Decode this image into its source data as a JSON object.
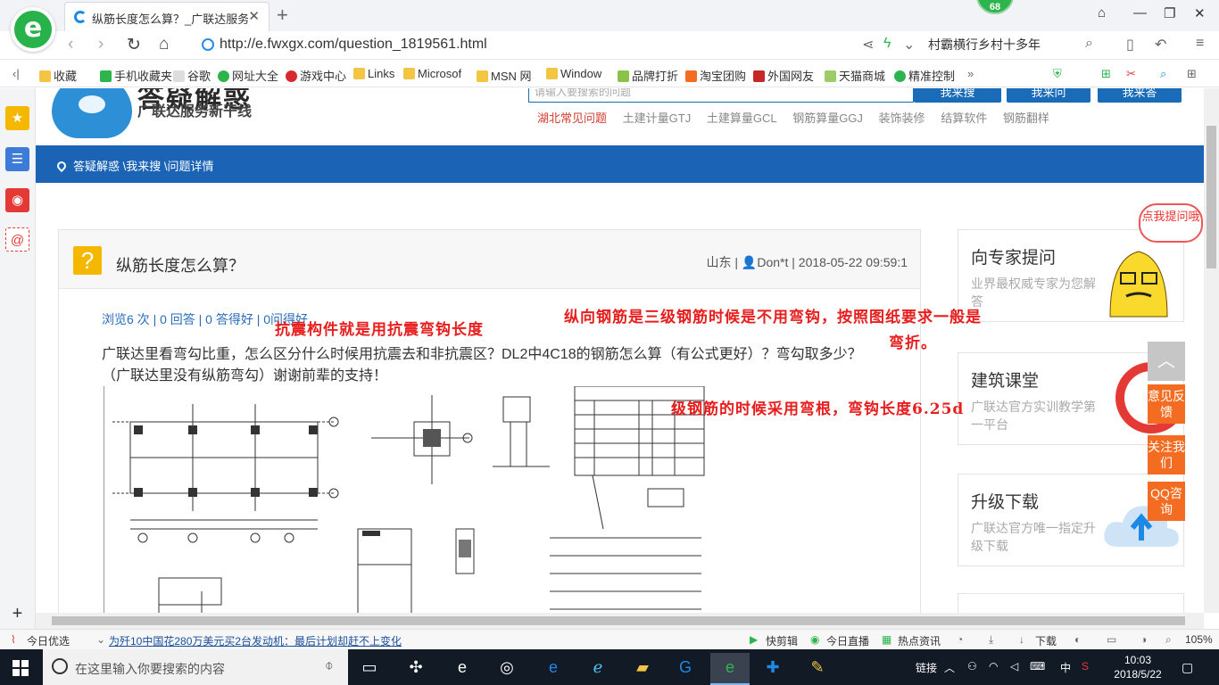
{
  "browser": {
    "tab_title": "纵筋长度怎么算？_广联达服务新",
    "tab_close": "✕",
    "new_tab": "+",
    "badge": "68",
    "url": "http://e.fwxgx.com/question_1819561.html",
    "search_text": "村霸横行乡村十多年"
  },
  "favorites": [
    {
      "label": "收藏",
      "color": "#f4c542"
    },
    {
      "label": "手机收藏夹",
      "color": "#2db44d"
    },
    {
      "label": "谷歌",
      "color": "#dddddd"
    },
    {
      "label": "网址大全",
      "color": "#2db44d"
    },
    {
      "label": "游戏中心",
      "color": "#d7282f"
    },
    {
      "label": "Links",
      "color": "#f4c542"
    },
    {
      "label": "Microsof",
      "color": "#f4c542"
    },
    {
      "label": "MSN 网",
      "color": "#f4c542"
    },
    {
      "label": "Window",
      "color": "#f4c542"
    },
    {
      "label": "品牌打折",
      "color": "#8bc34a"
    },
    {
      "label": "淘宝团购",
      "color": "#f36c21"
    },
    {
      "label": "外国网友",
      "color": "#c62828"
    },
    {
      "label": "天猫商城",
      "color": "#9ccc65"
    },
    {
      "label": "精准控制",
      "color": "#2db44d"
    }
  ],
  "page": {
    "logo_title": "答疑解惑",
    "logo_subtitle": "广联达服务新干线",
    "search_placeholder": "请输入要搜索的问题",
    "search_buttons": [
      "我来搜",
      "我来问",
      "我来答"
    ],
    "hotlinks": [
      "湖北常见问题",
      "土建计量GTJ",
      "土建算量GCL",
      "钢筋算量GGJ",
      "装饰装修",
      "结算软件",
      "钢筋翻样"
    ],
    "breadcrumb": "答疑解惑 \\我来搜 \\问题详情",
    "question": {
      "mark": "?",
      "title": "纵筋长度怎么算？",
      "meta_region": "山东",
      "meta_user": "Don*t",
      "meta_time": "2018-05-22 09:59:1",
      "stats": "浏览6 次 | 0 回答 | 0 答得好 | 0问得好",
      "body": "广联达里看弯勾比重，怎么区分什么时候用抗震去和非抗震区？DL2中4C18的钢筋怎么算（有公式更好）？弯勾取多少？（广联达里没有纵筋弯勾）谢谢前辈的支持！"
    },
    "cards": [
      {
        "title": "向专家提问",
        "desc": "业界最权威专家为您解答"
      },
      {
        "title": "建筑课堂",
        "desc": "广联达官方实训教学第一平台"
      },
      {
        "title": "升级下载",
        "desc": "广联达官方唯一指定升级下载"
      }
    ],
    "bubble": "点我提问哦",
    "float_feedback": "意见反馈",
    "float_follow": "关注我们",
    "float_qq": "QQ咨询"
  },
  "annotations": {
    "a1": "抗震构件就是用抗震弯钩长度",
    "a2": "纵向钢筋是三级钢筋时候是不用弯钩，按照图纸要求一般是",
    "a3": "弯折。",
    "a4": "级钢筋的时候采用弯根，弯钩长度6.25d"
  },
  "statusbar": {
    "left": "今日优选",
    "news": "为歼10中国花280万美元买2台发动机：最后计划却赶不上变化",
    "items": [
      "快剪辑",
      "今日直播",
      "热点资讯",
      "下载"
    ],
    "zoom": "105%"
  },
  "taskbar": {
    "search_placeholder": "在这里输入你要搜索的内容",
    "tray_link": "链接",
    "ime": "中",
    "time": "10:03",
    "date": "2018/5/22"
  }
}
